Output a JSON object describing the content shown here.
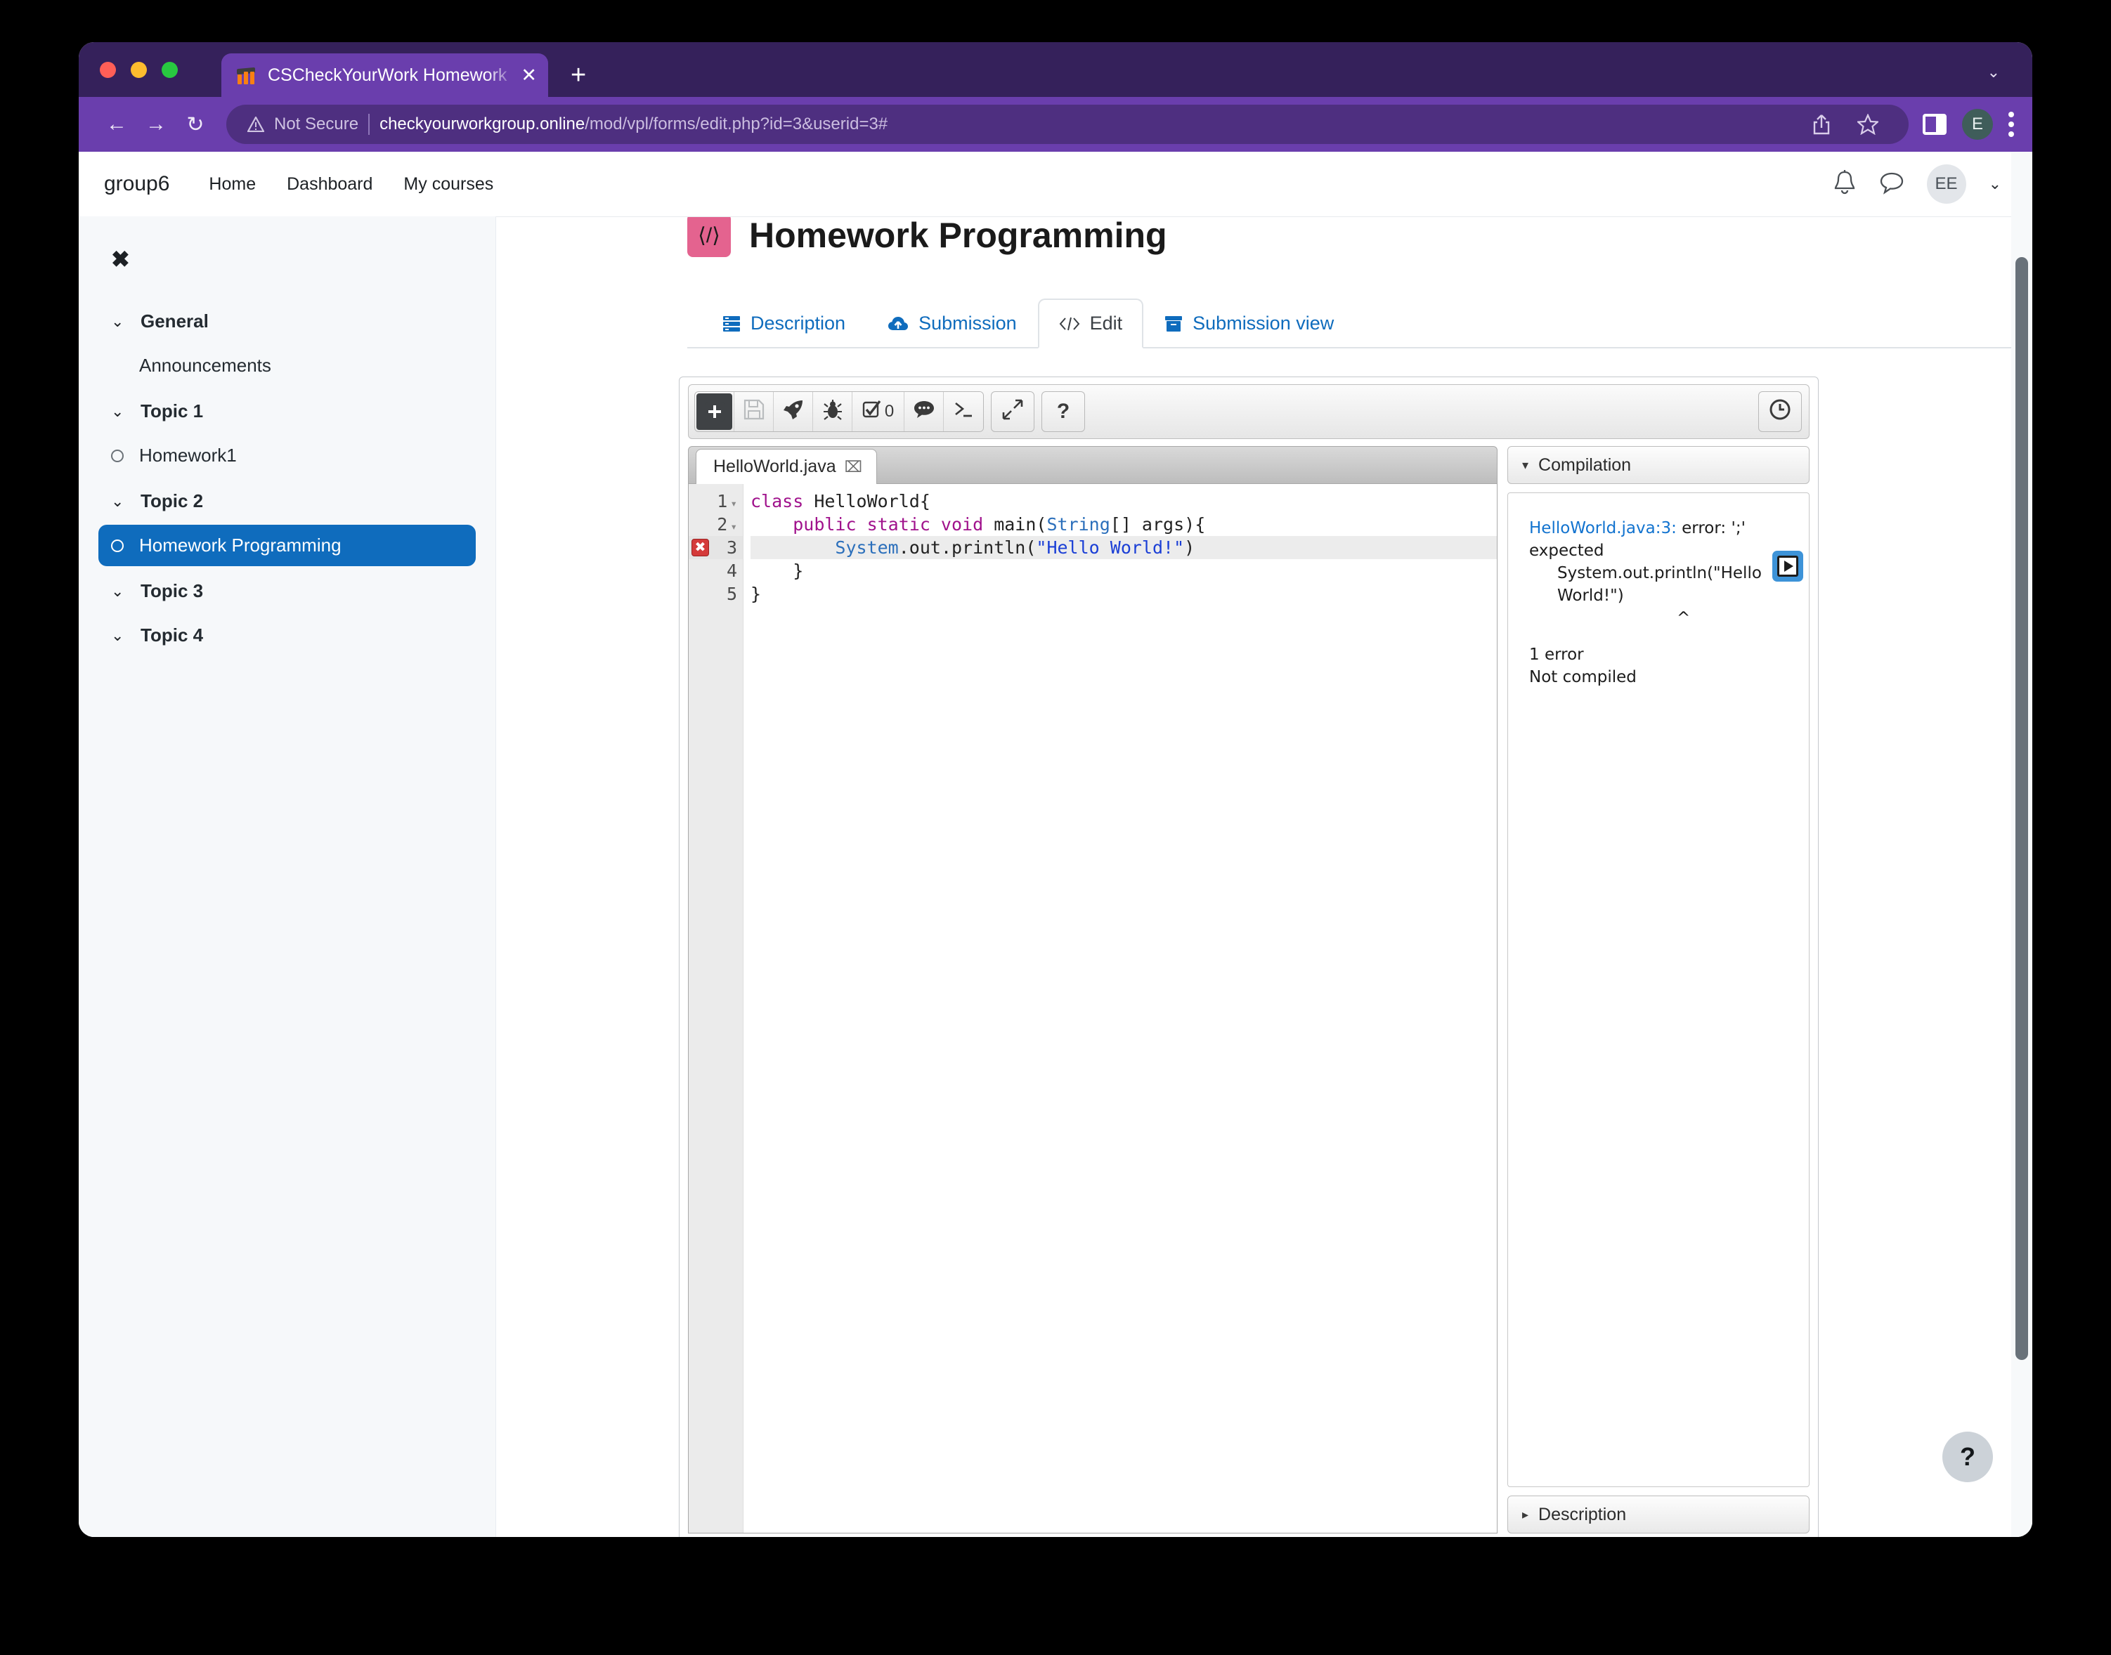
{
  "browser": {
    "tab": {
      "title": "CSCheckYourWork Homework",
      "favicon": "moodle-icon",
      "close": "✕"
    },
    "newtab_label": "+",
    "window_chevron": "⌄",
    "nav": {
      "back": "←",
      "forward": "→",
      "reload": "↻"
    },
    "omnibox": {
      "security_label": "Not Secure",
      "url_host": "checkyourworkgroup.online",
      "url_path": "/mod/vpl/forms/edit.php?id=3&userid=3#"
    },
    "actions": {
      "share": "share-icon",
      "bookmark": "☆",
      "sidepanel": "side-panel-icon",
      "profile": "E",
      "menu": "kebab-menu"
    }
  },
  "moodle": {
    "brand": "group6",
    "navlinks": [
      {
        "label": "Home"
      },
      {
        "label": "Dashboard"
      },
      {
        "label": "My courses"
      }
    ],
    "notifications_icon": "bell-icon",
    "messages_icon": "chat-bubble-icon",
    "avatar_initials": "EE",
    "user_chevron": "⌄"
  },
  "sidebar": {
    "close_label": "✖",
    "sections": [
      {
        "type": "section",
        "label": "General",
        "caret": "⌄"
      },
      {
        "type": "item",
        "label": "Announcements",
        "bullet": false,
        "active": false
      },
      {
        "type": "section",
        "label": "Topic 1",
        "caret": "⌄"
      },
      {
        "type": "item",
        "label": "Homework1",
        "bullet": true,
        "active": false
      },
      {
        "type": "section",
        "label": "Topic 2",
        "caret": "⌄"
      },
      {
        "type": "item",
        "label": "Homework Programming",
        "bullet": true,
        "active": true
      },
      {
        "type": "section",
        "label": "Topic 3",
        "caret": "⌄"
      },
      {
        "type": "section",
        "label": "Topic 4",
        "caret": "⌄"
      }
    ]
  },
  "activity": {
    "icon_glyph": "⟨/⟩",
    "icon_color": "#e4638f",
    "title": "Homework Programming",
    "tabs": [
      {
        "label": "Description",
        "icon": "list-icon",
        "active": false
      },
      {
        "label": "Submission",
        "icon": "cloud-upload-icon",
        "active": false
      },
      {
        "label": "Edit",
        "icon": "code-icon",
        "active": true
      },
      {
        "label": "Submission view",
        "icon": "archive-box-icon",
        "active": false
      }
    ]
  },
  "vpl": {
    "toolbar": [
      {
        "name": "new-file-button",
        "icon": "plus-square-icon",
        "glyph": "➕",
        "state": "primary"
      },
      {
        "name": "save-button",
        "icon": "floppy-disk-icon",
        "glyph": "💾",
        "state": "disabled"
      },
      {
        "name": "run-button",
        "icon": "rocket-icon",
        "glyph": "🚀",
        "state": "normal"
      },
      {
        "name": "debug-button",
        "icon": "bug-icon",
        "glyph": "🐞",
        "state": "normal"
      },
      {
        "name": "evaluate-button",
        "icon": "checkbox-icon",
        "glyph": "☑",
        "badge": "0",
        "state": "normal"
      },
      {
        "name": "comments-button",
        "icon": "comment-icon",
        "glyph": "💬",
        "state": "normal"
      },
      {
        "name": "console-button",
        "icon": "terminal-icon",
        "glyph": ">_",
        "state": "normal"
      },
      {
        "name": "fullscreen-button",
        "icon": "expand-arrows-icon",
        "glyph": "⤡",
        "state": "standalone"
      },
      {
        "name": "help-button",
        "icon": "question-mark-icon",
        "glyph": "?",
        "state": "standalone"
      }
    ],
    "timer_icon": "clock-icon",
    "file_tab": {
      "name": "HelloWorld.java",
      "close": "⌧"
    },
    "editor": {
      "lines": [
        {
          "num": "1",
          "fold": true,
          "error": false,
          "highlight": false,
          "tokens": [
            {
              "t": "class ",
              "c": "kw"
            },
            {
              "t": "HelloWorld{",
              "c": "plain"
            }
          ]
        },
        {
          "num": "2",
          "fold": true,
          "error": false,
          "highlight": false,
          "tokens": [
            {
              "t": "    ",
              "c": "plain"
            },
            {
              "t": "public static void ",
              "c": "kw"
            },
            {
              "t": "main(",
              "c": "plain"
            },
            {
              "t": "String",
              "c": "typ"
            },
            {
              "t": "[] args){",
              "c": "plain"
            }
          ]
        },
        {
          "num": "3",
          "fold": false,
          "error": true,
          "highlight": true,
          "tokens": [
            {
              "t": "        ",
              "c": "plain"
            },
            {
              "t": "System",
              "c": "typ"
            },
            {
              "t": ".out.println(",
              "c": "plain"
            },
            {
              "t": "\"Hello World!\"",
              "c": "str"
            },
            {
              "t": ")",
              "c": "plain"
            }
          ]
        },
        {
          "num": "4",
          "fold": false,
          "error": false,
          "highlight": false,
          "tokens": [
            {
              "t": "    }",
              "c": "plain"
            }
          ]
        },
        {
          "num": "5",
          "fold": false,
          "error": false,
          "highlight": false,
          "tokens": [
            {
              "t": "}",
              "c": "plain"
            }
          ]
        }
      ],
      "error_marker": "✖"
    },
    "compilation": {
      "header": "Compilation",
      "caret": "▾",
      "error_file_line": "HelloWorld.java:3:",
      "error_message": " error: ';' expected",
      "error_source": "System.out.println(\"Hello World!\")",
      "error_caret": "^",
      "error_count": "1 error",
      "status": "Not compiled",
      "run_badge_icon": "play-button-icon"
    },
    "description_accordion": {
      "label": "Description",
      "caret": "▸"
    }
  },
  "help_fab": {
    "label": "?"
  }
}
